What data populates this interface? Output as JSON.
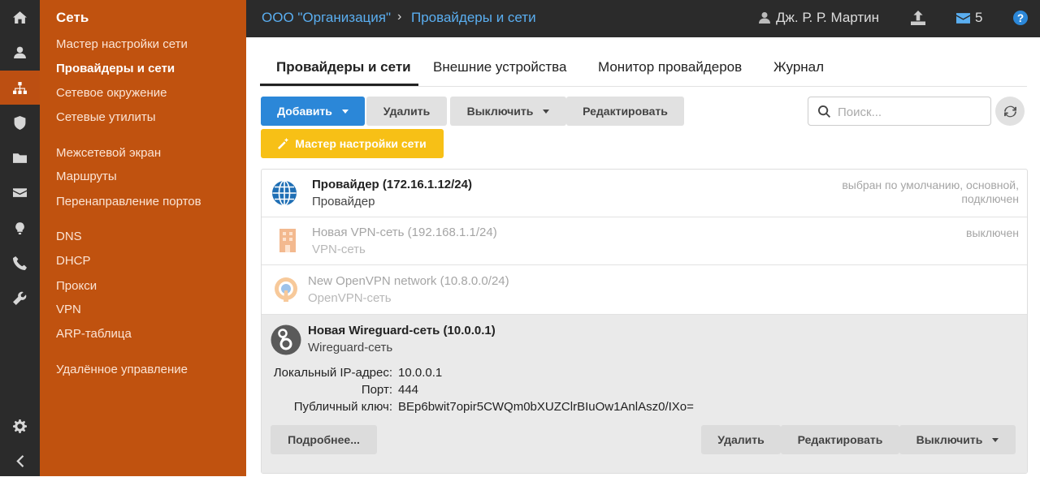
{
  "iconbar": {
    "items": [
      {
        "icon": "home-icon"
      },
      {
        "icon": "user-icon"
      },
      {
        "icon": "sitemap-icon",
        "active": true
      },
      {
        "icon": "shield-icon"
      },
      {
        "icon": "folder-icon"
      },
      {
        "icon": "envelope-icon"
      },
      {
        "icon": "lightbulb-icon"
      },
      {
        "icon": "phone-icon"
      },
      {
        "icon": "wrench-icon"
      },
      {
        "icon": "gear-icon"
      },
      {
        "icon": "chevron-left-icon"
      }
    ]
  },
  "sidebar": {
    "title": "Сеть",
    "items": [
      {
        "label": "Мастер настройки сети"
      },
      {
        "label": "Провайдеры и сети",
        "active": true
      },
      {
        "label": "Сетевое окружение"
      },
      {
        "label": "Сетевые утилиты"
      },
      {
        "label": "Межсетевой экран"
      },
      {
        "label": "Маршруты"
      },
      {
        "label": "Перенаправление портов"
      },
      {
        "label": "DNS"
      },
      {
        "label": "DHCP"
      },
      {
        "label": "Прокси"
      },
      {
        "label": "VPN"
      },
      {
        "label": "ARP-таблица"
      },
      {
        "label": "Удалённое управление"
      }
    ]
  },
  "topbar": {
    "breadcrumb_org": "ООО \"Организация\"",
    "breadcrumb_page": "Провайдеры и сети",
    "user_name": "Дж. Р. Р. Мартин",
    "mail_count": "5"
  },
  "tabs": [
    {
      "label": "Провайдеры и сети",
      "active": true
    },
    {
      "label": "Внешние устройства"
    },
    {
      "label": "Монитор провайдеров"
    },
    {
      "label": "Журнал"
    }
  ],
  "toolbar": {
    "add": "Добавить",
    "delete": "Удалить",
    "disable": "Выключить",
    "edit": "Редактировать",
    "wizard": "Мастер настройки сети",
    "search_placeholder": "Поиск..."
  },
  "networks": [
    {
      "name": "Провайдер (172.16.1.12/24)",
      "type": "Провайдер",
      "status_line1": "выбран по умолчанию, основной,",
      "status_line2": "подключен",
      "icon": "globe-icon"
    },
    {
      "name": "Новая VPN-сеть (192.168.1.1/24)",
      "type": "VPN-сеть",
      "status_line1": "выключен",
      "icon": "building-icon"
    },
    {
      "name": "New OpenVPN network (10.8.0.0/24)",
      "type": "OpenVPN-сеть",
      "icon": "openvpn-icon"
    },
    {
      "name": "Новая Wireguard-сеть (10.0.0.1)",
      "type": "Wireguard-сеть",
      "icon": "wireguard-icon",
      "details": {
        "ip_label": "Локальный IP-адрес:",
        "ip_value": "10.0.0.1",
        "port_label": "Порт:",
        "port_value": "444",
        "key_label": "Публичный ключ:",
        "key_value": "BEp6bwit7opir5CWQm0bXUZClrBIuOw1AnlAsz0/IXo="
      },
      "actions": {
        "more": "Подробнее...",
        "delete": "Удалить",
        "edit": "Редактировать",
        "disable": "Выключить"
      }
    }
  ],
  "colors": {
    "sidebar": "#c0520f",
    "dark": "#2b2b2b",
    "primary": "#2b87d8",
    "warn": "#f7c016",
    "link": "#5aaef0"
  }
}
